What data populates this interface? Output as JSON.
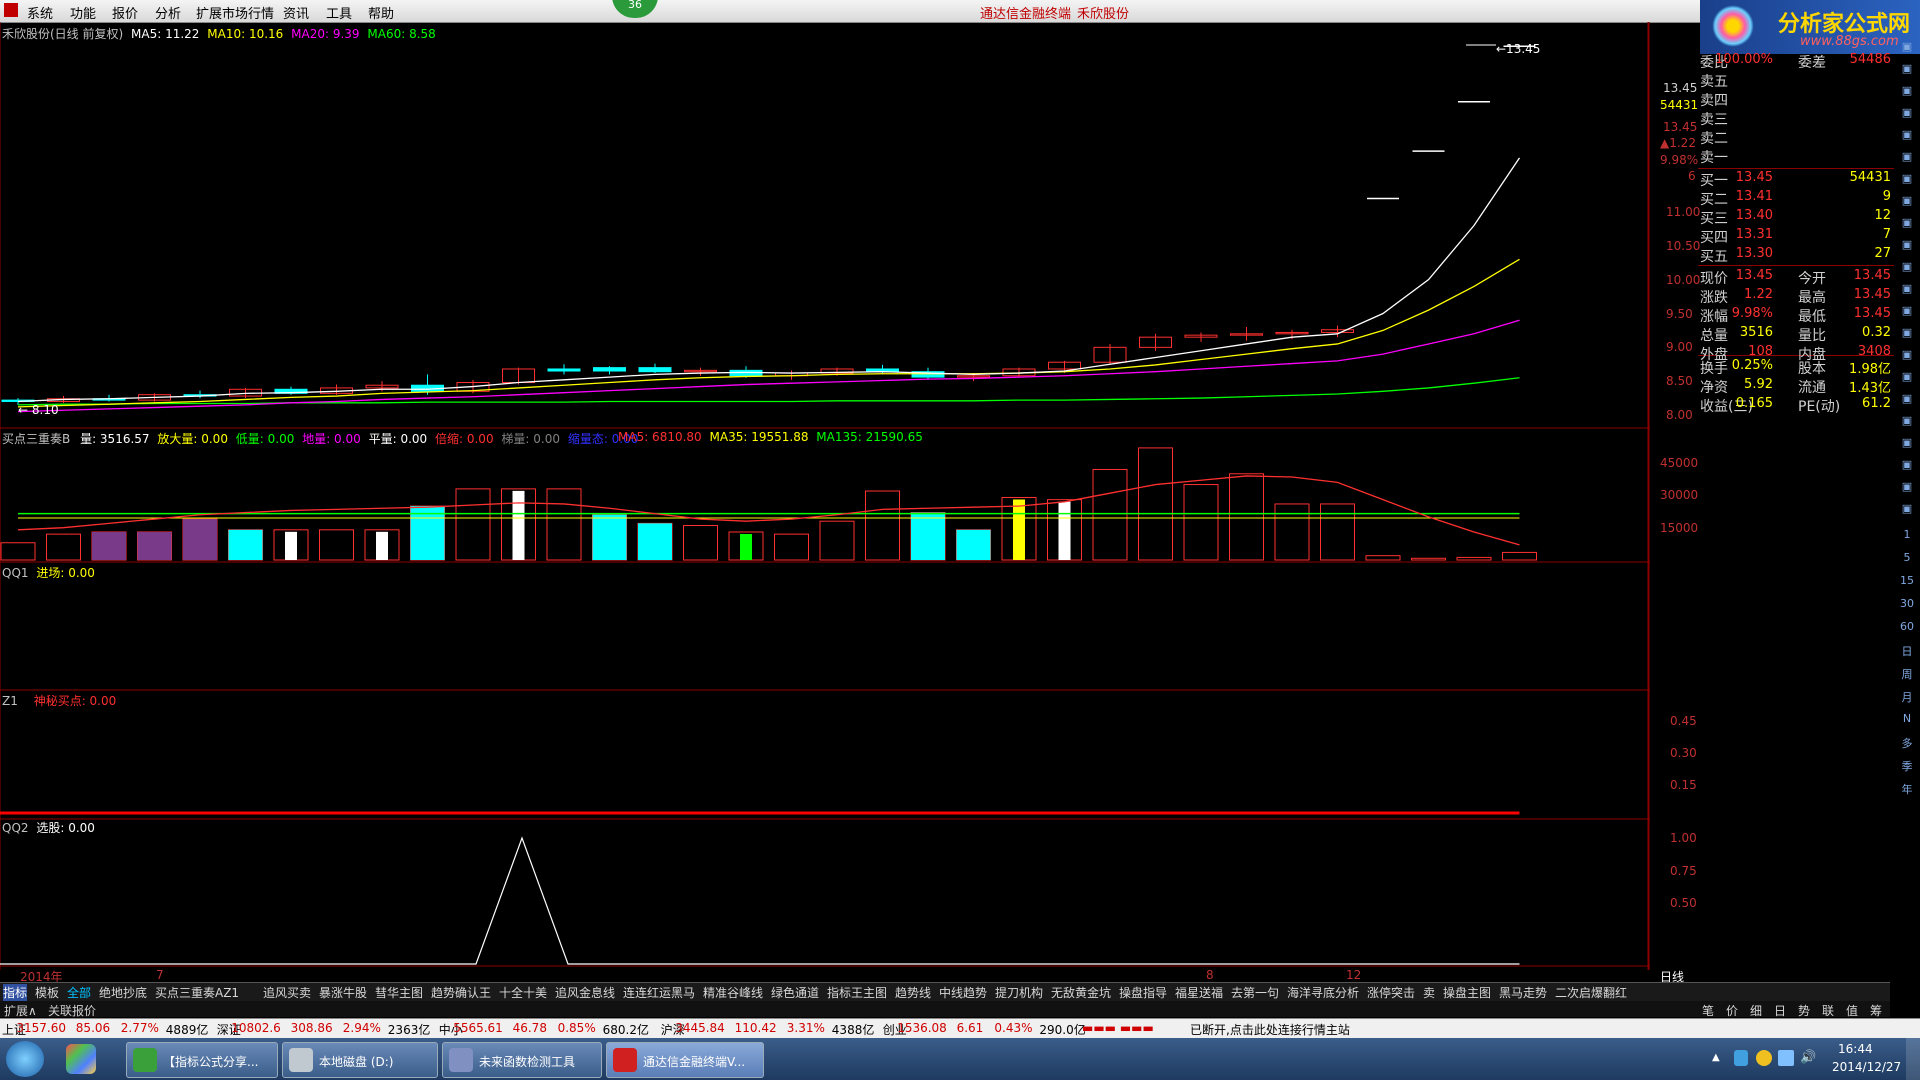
{
  "menu": {
    "items": [
      "系统",
      "功能",
      "报价",
      "分析",
      "扩展市场行情",
      "资讯",
      "工具",
      "帮助"
    ],
    "badge": "36",
    "title_app": "通达信金融终端",
    "title_stock": "禾欣股份"
  },
  "logo": {
    "name": "分析家公式网",
    "url_text": "www.88gs.com"
  },
  "main_chart": {
    "header": {
      "name": "禾欣股份(日线 前复权)",
      "ma5": "MA5: 11.22",
      "ma10": "MA10: 10.16",
      "ma20": "MA20: 9.39",
      "ma60": "MA60: 8.58"
    },
    "high_label": "13.45",
    "low_label": "8.10",
    "price_axis": [
      "11.00",
      "10.50",
      "10.00",
      "9.50",
      "9.00",
      "8.50",
      "8.00"
    ],
    "right_info": {
      "price": "13.45",
      "vol": "54431",
      "price2": "13.45",
      "chg": "▲1.22",
      "pct": "9.98%",
      "num": "6"
    },
    "ohlc": [
      [
        8.22,
        8.25,
        8.15,
        8.2
      ],
      [
        8.2,
        8.28,
        8.18,
        8.24
      ],
      [
        8.24,
        8.3,
        8.2,
        8.22
      ],
      [
        8.22,
        8.32,
        8.2,
        8.3
      ],
      [
        8.3,
        8.36,
        8.25,
        8.28
      ],
      [
        8.28,
        8.4,
        8.25,
        8.38
      ],
      [
        8.38,
        8.42,
        8.3,
        8.32
      ],
      [
        8.32,
        8.45,
        8.3,
        8.4
      ],
      [
        8.4,
        8.5,
        8.35,
        8.44
      ],
      [
        8.44,
        8.6,
        8.3,
        8.35
      ],
      [
        8.35,
        8.52,
        8.32,
        8.48
      ],
      [
        8.48,
        8.7,
        8.45,
        8.68
      ],
      [
        8.68,
        8.75,
        8.6,
        8.65
      ],
      [
        8.65,
        8.72,
        8.6,
        8.7
      ],
      [
        8.7,
        8.76,
        8.62,
        8.64
      ],
      [
        8.64,
        8.7,
        8.58,
        8.66
      ],
      [
        8.66,
        8.72,
        8.55,
        8.58
      ],
      [
        8.58,
        8.66,
        8.52,
        8.62
      ],
      [
        8.62,
        8.7,
        8.58,
        8.68
      ],
      [
        8.68,
        8.74,
        8.6,
        8.64
      ],
      [
        8.64,
        8.7,
        8.52,
        8.56
      ],
      [
        8.56,
        8.62,
        8.5,
        8.58
      ],
      [
        8.58,
        8.7,
        8.55,
        8.68
      ],
      [
        8.68,
        8.8,
        8.62,
        8.78
      ],
      [
        8.78,
        9.05,
        8.75,
        9.0
      ],
      [
        9.0,
        9.2,
        8.95,
        9.15
      ],
      [
        9.15,
        9.22,
        9.08,
        9.18
      ],
      [
        9.18,
        9.3,
        9.1,
        9.2
      ],
      [
        9.2,
        9.26,
        9.12,
        9.22
      ],
      [
        9.22,
        9.32,
        9.15,
        9.26
      ],
      [
        11.2,
        11.2,
        11.2,
        11.2
      ],
      [
        11.9,
        11.9,
        11.9,
        11.9
      ],
      [
        12.63,
        12.63,
        12.63,
        12.63
      ],
      [
        13.45,
        13.45,
        13.45,
        13.45
      ]
    ],
    "ma_white": [
      8.2,
      8.23,
      8.24,
      8.26,
      8.28,
      8.32,
      8.33,
      8.35,
      8.38,
      8.38,
      8.42,
      8.48,
      8.52,
      8.56,
      8.6,
      8.62,
      8.63,
      8.62,
      8.63,
      8.64,
      8.62,
      8.6,
      8.62,
      8.65,
      8.75,
      8.85,
      8.95,
      9.05,
      9.15,
      9.2,
      9.5,
      10.0,
      10.8,
      11.8
    ],
    "ma_yellow": [
      8.12,
      8.14,
      8.16,
      8.18,
      8.2,
      8.23,
      8.26,
      8.28,
      8.32,
      8.34,
      8.36,
      8.4,
      8.44,
      8.48,
      8.52,
      8.55,
      8.57,
      8.58,
      8.6,
      8.61,
      8.61,
      8.61,
      8.62,
      8.64,
      8.68,
      8.74,
      8.82,
      8.9,
      8.98,
      9.05,
      9.25,
      9.55,
      9.9,
      10.3
    ],
    "ma_magenta": [
      8.05,
      8.07,
      8.09,
      8.11,
      8.13,
      8.15,
      8.18,
      8.2,
      8.23,
      8.25,
      8.27,
      8.3,
      8.33,
      8.36,
      8.39,
      8.42,
      8.45,
      8.47,
      8.49,
      8.51,
      8.53,
      8.54,
      8.56,
      8.58,
      8.61,
      8.64,
      8.68,
      8.72,
      8.76,
      8.8,
      8.9,
      9.05,
      9.2,
      9.4
    ],
    "ma_green": [
      8.15,
      8.16,
      8.16,
      8.17,
      8.17,
      8.17,
      8.18,
      8.18,
      8.18,
      8.19,
      8.19,
      8.19,
      8.19,
      8.2,
      8.2,
      8.2,
      8.2,
      8.2,
      8.21,
      8.21,
      8.21,
      8.21,
      8.22,
      8.22,
      8.23,
      8.24,
      8.25,
      8.27,
      8.29,
      8.31,
      8.35,
      8.4,
      8.47,
      8.55
    ]
  },
  "vol_panel": {
    "header": {
      "name": "买点三重奏B",
      "v1": "量: 3516.57",
      "v2": "放大量: 0.00",
      "v3": "低量: 0.00",
      "v4": "地量: 0.00",
      "v5": "平量: 0.00",
      "v6": "倍缩: 0.00",
      "v7": "梯量: 0.00",
      "v8": "缩量态: 0.00",
      "ma5": "MA5: 6810.80",
      "ma35": "MA35: 19551.88",
      "ma135": "MA135: 21590.65"
    },
    "axis": [
      "45000",
      "30000",
      "15000"
    ],
    "bars": [
      8000,
      12000,
      13000,
      13000,
      19000,
      14000,
      14000,
      14000,
      14000,
      25000,
      33000,
      33000,
      33000,
      21000,
      17000,
      16000,
      13000,
      12000,
      18000,
      32000,
      22000,
      14000,
      29000,
      28000,
      42000,
      52000,
      35000,
      40000,
      26000,
      26000,
      2000,
      800,
      1200,
      3516
    ],
    "bar_types": [
      "hollow",
      "hollow",
      "purple",
      "purple",
      "purple",
      "cyan",
      "white",
      "hollow",
      "white",
      "cyan",
      "hollow",
      "white",
      "hollow",
      "cyan",
      "cyan",
      "hollow",
      "green",
      "hollow",
      "hollow",
      "hollow",
      "cyan",
      "cyan",
      "yellow",
      "white",
      "hollow",
      "hollow",
      "hollow",
      "hollow",
      "hollow",
      "hollow",
      "hollow",
      "hollow",
      "hollow",
      "hollow"
    ],
    "ma_red": [
      14000,
      15000,
      17000,
      19000,
      21000,
      22000,
      23000,
      23500,
      24000,
      24500,
      25500,
      26500,
      26000,
      24000,
      21500,
      19000,
      18000,
      19000,
      21000,
      23500,
      24000,
      24500,
      25000,
      27000,
      31000,
      35000,
      37000,
      39000,
      38500,
      36000,
      28000,
      20000,
      13000,
      7000
    ],
    "ma_green_v": 21500,
    "ma_yellow_v": 19500
  },
  "qq1_panel": {
    "header": {
      "name": "QQ1",
      "v": "进场: 0.00"
    }
  },
  "z1_panel": {
    "header": {
      "name": "Z1",
      "v": "神秘买点: 0.00"
    },
    "axis": [
      "0.45",
      "0.30",
      "0.15"
    ]
  },
  "qq2_panel": {
    "header": {
      "name": "QQ2",
      "v": "选股: 0.00"
    },
    "axis": [
      "1.00",
      "0.75",
      "0.50"
    ]
  },
  "date_axis": {
    "labels": [
      "2014年",
      "7",
      "8",
      "12"
    ],
    "period": "日线"
  },
  "quote": {
    "weibi": {
      "label": "委比",
      "pct": "100.00%",
      "label2": "委差",
      "val": "54486"
    },
    "sell": [
      "卖五",
      "卖四",
      "卖三",
      "卖二",
      "卖一"
    ],
    "buy": [
      {
        "l": "买一",
        "p": "13.45",
        "v": "54431"
      },
      {
        "l": "买二",
        "p": "13.41",
        "v": "9"
      },
      {
        "l": "买三",
        "p": "13.40",
        "v": "12"
      },
      {
        "l": "买四",
        "p": "13.31",
        "v": "7"
      },
      {
        "l": "买五",
        "p": "13.30",
        "v": "27"
      }
    ],
    "stats": [
      {
        "l1": "现价",
        "v1": "13.45",
        "l2": "今开",
        "v2": "13.45"
      },
      {
        "l1": "涨跌",
        "v1": "1.22",
        "l2": "最高",
        "v2": "13.45"
      },
      {
        "l1": "涨幅",
        "v1": "9.98%",
        "l2": "最低",
        "v2": "13.45"
      },
      {
        "l1": "总量",
        "v1": "3516",
        "l2": "量比",
        "v2": "0.32"
      },
      {
        "l1": "外盘",
        "v1": "108",
        "l2": "内盘",
        "v2": "3408"
      }
    ],
    "stats2": [
      {
        "l1": "换手",
        "v1": "0.25%",
        "l2": "股本",
        "v2": "1.98亿"
      },
      {
        "l1": "净资",
        "v1": "5.92",
        "l2": "流通",
        "v2": "1.43亿"
      },
      {
        "l1": "收益(三)",
        "v1": "0.165",
        "l2": "PE(动)",
        "v2": "61.2"
      }
    ]
  },
  "right_tools": [
    "1",
    "5",
    "15",
    "30",
    "60",
    "日",
    "周",
    "月",
    "N",
    "多",
    "季",
    "年"
  ],
  "bottom_tabs": [
    "指标",
    "模板",
    "全部",
    "绝地抄底",
    "买点三重奏AZ1",
    "追风买卖",
    "暴涨牛股",
    "彗华主图",
    "趋势确认王",
    "十全十美",
    "追风金息线",
    "连连红运黑马",
    "精准谷峰线",
    "绿色通道",
    "指标王主图",
    "趋势线",
    "中线趋势",
    "提刀机构",
    "无敌黄金坑",
    "操盘指导",
    "福星送福",
    "去第一句",
    "海洋寻底分析",
    "涨停突击",
    "卖",
    "操盘主图",
    "黑马走势",
    "二次启爆翻红"
  ],
  "sub_tabs": [
    "扩展∧",
    "关联报价"
  ],
  "quote_tabs": [
    "笔",
    "价",
    "细",
    "日",
    "势",
    "联",
    "值",
    "筹"
  ],
  "status": {
    "sh": {
      "l": "上证",
      "p": "3157.60",
      "c": "85.06",
      "pct": "2.77%",
      "amt": "4889亿"
    },
    "sz": {
      "l": "深证",
      "p": "10802.6",
      "c": "308.86",
      "pct": "2.94%",
      "amt": "2363亿"
    },
    "zx": {
      "l": "中小",
      "p": "5565.61",
      "c": "46.78",
      "pct": "0.85%",
      "amt": "680.2亿"
    },
    "hs": {
      "l": "沪深",
      "p": "3445.84",
      "c": "110.42",
      "pct": "3.31%",
      "amt": "4388亿"
    },
    "cy": {
      "l": "创业",
      "p": "1536.08",
      "c": "6.61",
      "pct": "0.43%",
      "amt": "290.0亿"
    },
    "msg": "已断开,点击此处连接行情主站"
  },
  "taskbar": {
    "tasks": [
      "【指标公式分享...",
      "本地磁盘 (D:)",
      "未来函数检测工具",
      "通达信金融终端V..."
    ],
    "time": "16:44",
    "date": "2014/12/27"
  },
  "colors": {
    "up": "#ff3030",
    "down": "#00ffff",
    "ma_white": "#ffffff",
    "ma_yellow": "#ffff00",
    "ma_magenta": "#ff00ff",
    "ma_green": "#00ff00",
    "grid": "#8b0000"
  }
}
